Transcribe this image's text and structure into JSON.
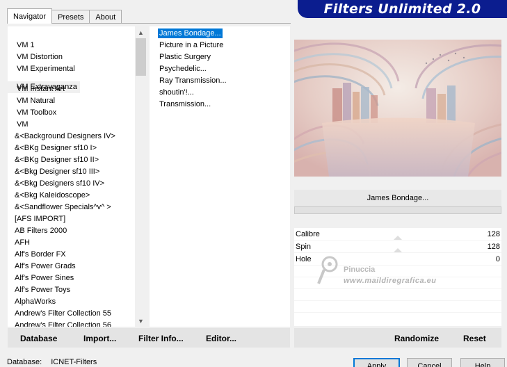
{
  "window": {
    "title": "Filters Unlimited 2.0"
  },
  "tabs": [
    {
      "label": "Navigator",
      "active": true
    },
    {
      "label": "Presets",
      "active": false
    },
    {
      "label": "About",
      "active": false
    }
  ],
  "categories": [
    "VM 1",
    "VM Distortion",
    "VM Experimental",
    "VM Extravaganza",
    "VM Instant Art",
    "VM Natural",
    "VM Toolbox",
    "VM",
    "&<Background Designers IV>",
    "&<BKg Designer sf10 I>",
    "&<BKg Designer sf10 II>",
    "&<Bkg Designer sf10 III>",
    "&<Bkg Designers sf10 IV>",
    "&<Bkg Kaleidoscope>",
    "&<Sandflower Specials^v^ >",
    "[AFS IMPORT]",
    "AB Filters 2000",
    "AFH",
    "Alf's Border FX",
    "Alf's Power Grads",
    "Alf's Power Sines",
    "Alf's Power Toys",
    "AlphaWorks",
    "Andrew's Filter Collection 55",
    "Andrew's Filter Collection 56"
  ],
  "selected_category": "VM Extravaganza",
  "filters": [
    "James Bondage...",
    "Picture in a Picture",
    "Plastic Surgery",
    "Psychedelic...",
    "Ray Transmission...",
    "shoutin'!...",
    "Transmission..."
  ],
  "selected_filter": "James Bondage...",
  "preview": {
    "filter_name": "James Bondage..."
  },
  "params": [
    {
      "name": "Calibre",
      "value": "128"
    },
    {
      "name": "Spin",
      "value": "128"
    },
    {
      "name": "Hole",
      "value": "0"
    }
  ],
  "watermark": {
    "line1": "Pinuccia",
    "line2": "www.maildiregrafica.eu"
  },
  "left_buttons": {
    "database": "Database",
    "import": "Import...",
    "filter_info": "Filter Info...",
    "editor": "Editor..."
  },
  "right_buttons": {
    "randomize": "Randomize",
    "reset": "Reset"
  },
  "status": {
    "label": "Database:",
    "value": "ICNET-Filters"
  },
  "dialog_buttons": {
    "apply": "Apply",
    "cancel": "Cancel",
    "help": "Help"
  },
  "colors": {
    "banner": "#0b1d8f",
    "selection": "#0078d7"
  }
}
